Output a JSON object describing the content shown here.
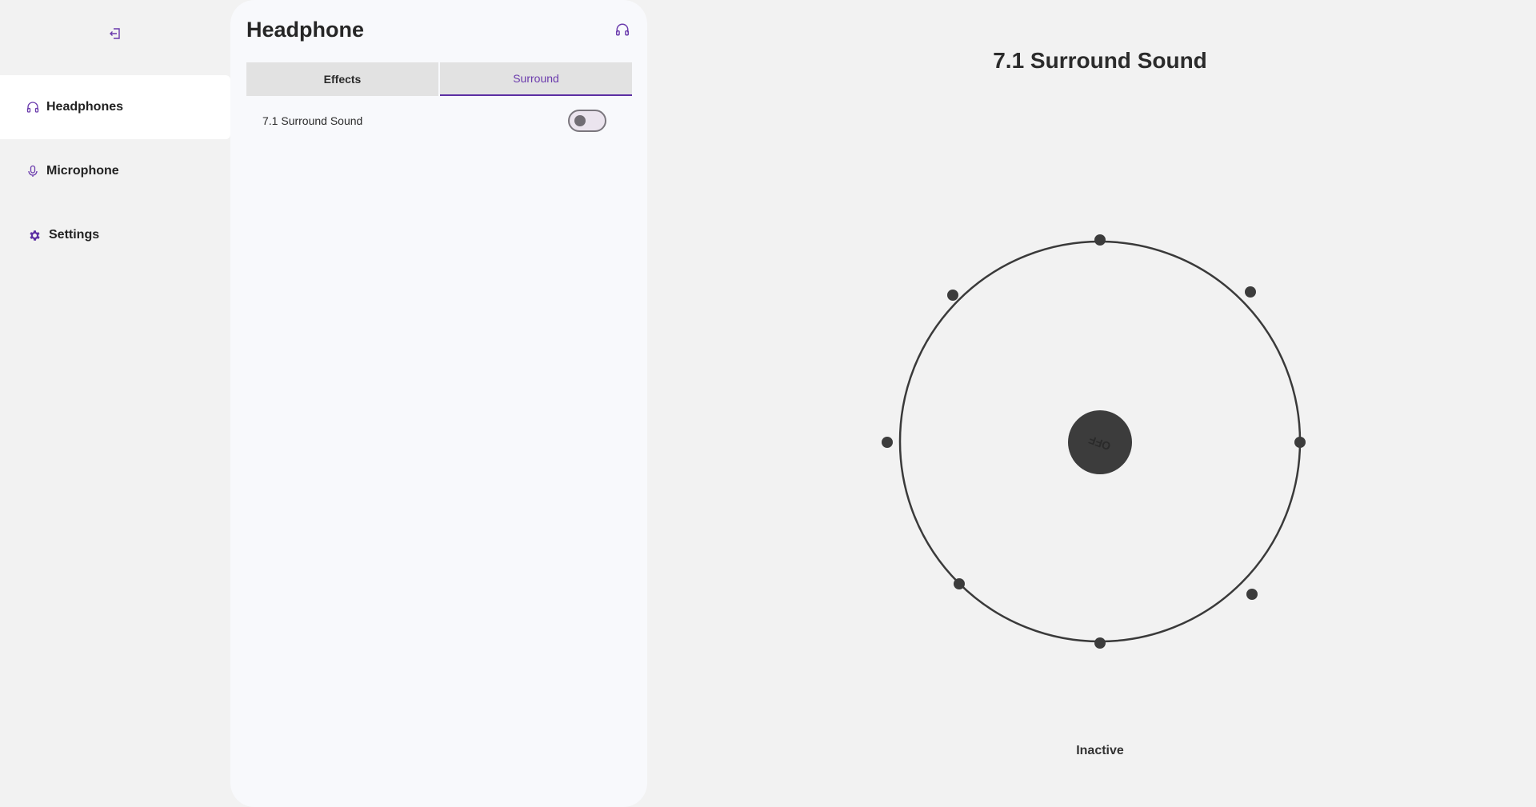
{
  "nav": {
    "exit_icon": "exit-icon",
    "items": [
      {
        "label": "Headphones",
        "icon": "headphones-icon",
        "active": true
      },
      {
        "label": "Microphone",
        "icon": "microphone-icon",
        "active": false
      },
      {
        "label": "Settings",
        "icon": "gear-icon",
        "active": false
      }
    ]
  },
  "panel": {
    "title": "Headphone",
    "header_icon": "headphones-icon",
    "tabs": [
      {
        "label": "Effects",
        "active": false
      },
      {
        "label": "Surround",
        "active": true
      }
    ],
    "settings": [
      {
        "label": "7.1 Surround Sound",
        "enabled": false
      }
    ]
  },
  "visualizer": {
    "title": "7.1 Surround Sound",
    "center_label": "OFF",
    "status": "Inactive",
    "speaker_count": 8
  },
  "colors": {
    "accent": "#5c2fa3",
    "dark": "#3c3c3c",
    "panel_bg": "#f8f9fc",
    "page_bg": "#f2f2f2"
  }
}
